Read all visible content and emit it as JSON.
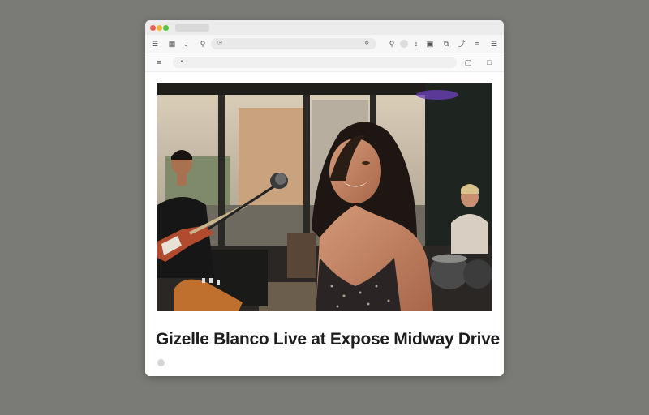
{
  "browser": {
    "tab_label": "",
    "url": "",
    "page_url": ""
  },
  "toolbar_icons": [
    "sidebar-icon",
    "tab-overview-icon",
    "chevron-down-icon",
    "search-icon",
    "shield-icon",
    "refresh-icon",
    "avatar-icon",
    "download-icon",
    "reader-icon",
    "share-icon",
    "extensions-icon",
    "menu-icon",
    "more-icon"
  ],
  "article": {
    "kicker": "",
    "headline": "Gizelle Blanco Live at Expose Midway Drive",
    "byline": "",
    "hero_alt": "Smiling singer at a microphone with guitarist and drummer behind her on a small stage"
  },
  "colors": {
    "background": "#7a7a76",
    "window": "#ffffff",
    "headline": "#1d1d1d",
    "traffic_red": "#ee5b53",
    "traffic_yellow": "#f2b43a",
    "traffic_green": "#56c13e"
  }
}
